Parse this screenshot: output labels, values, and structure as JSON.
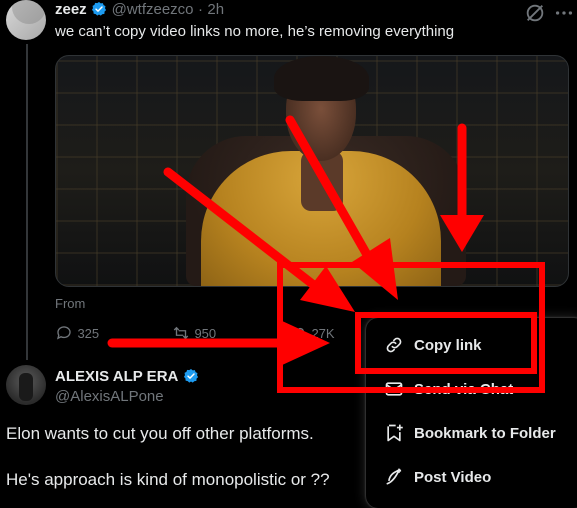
{
  "tweet1": {
    "name": "zeez",
    "handle": "@wtfzeezco",
    "separator": "·",
    "time": "2h",
    "text": "we can’t copy video links no more, he’s removing everything",
    "from_label": "From",
    "stats": {
      "replies": "325",
      "retweets": "950",
      "likes": "27K"
    }
  },
  "tweet2": {
    "name": "ALEXIS ALP ERA",
    "handle": "@AlexisALPone",
    "text_line1": "Elon wants to cut you off other platforms.",
    "text_line2": "He's approach is kind of monopolistic or ??"
  },
  "menu": {
    "items": [
      {
        "label": "Copy link",
        "icon": "link-icon"
      },
      {
        "label": "Send via Chat",
        "icon": "envelope-icon"
      },
      {
        "label": "Bookmark to Folder",
        "icon": "bookmark-plus-icon"
      },
      {
        "label": "Post Video",
        "icon": "post-video-icon"
      }
    ]
  },
  "colors": {
    "background": "#000000",
    "text": "#e7e9ea",
    "muted": "#71767b",
    "verified": "#1d9bf0",
    "annotation": "#ff0000"
  }
}
